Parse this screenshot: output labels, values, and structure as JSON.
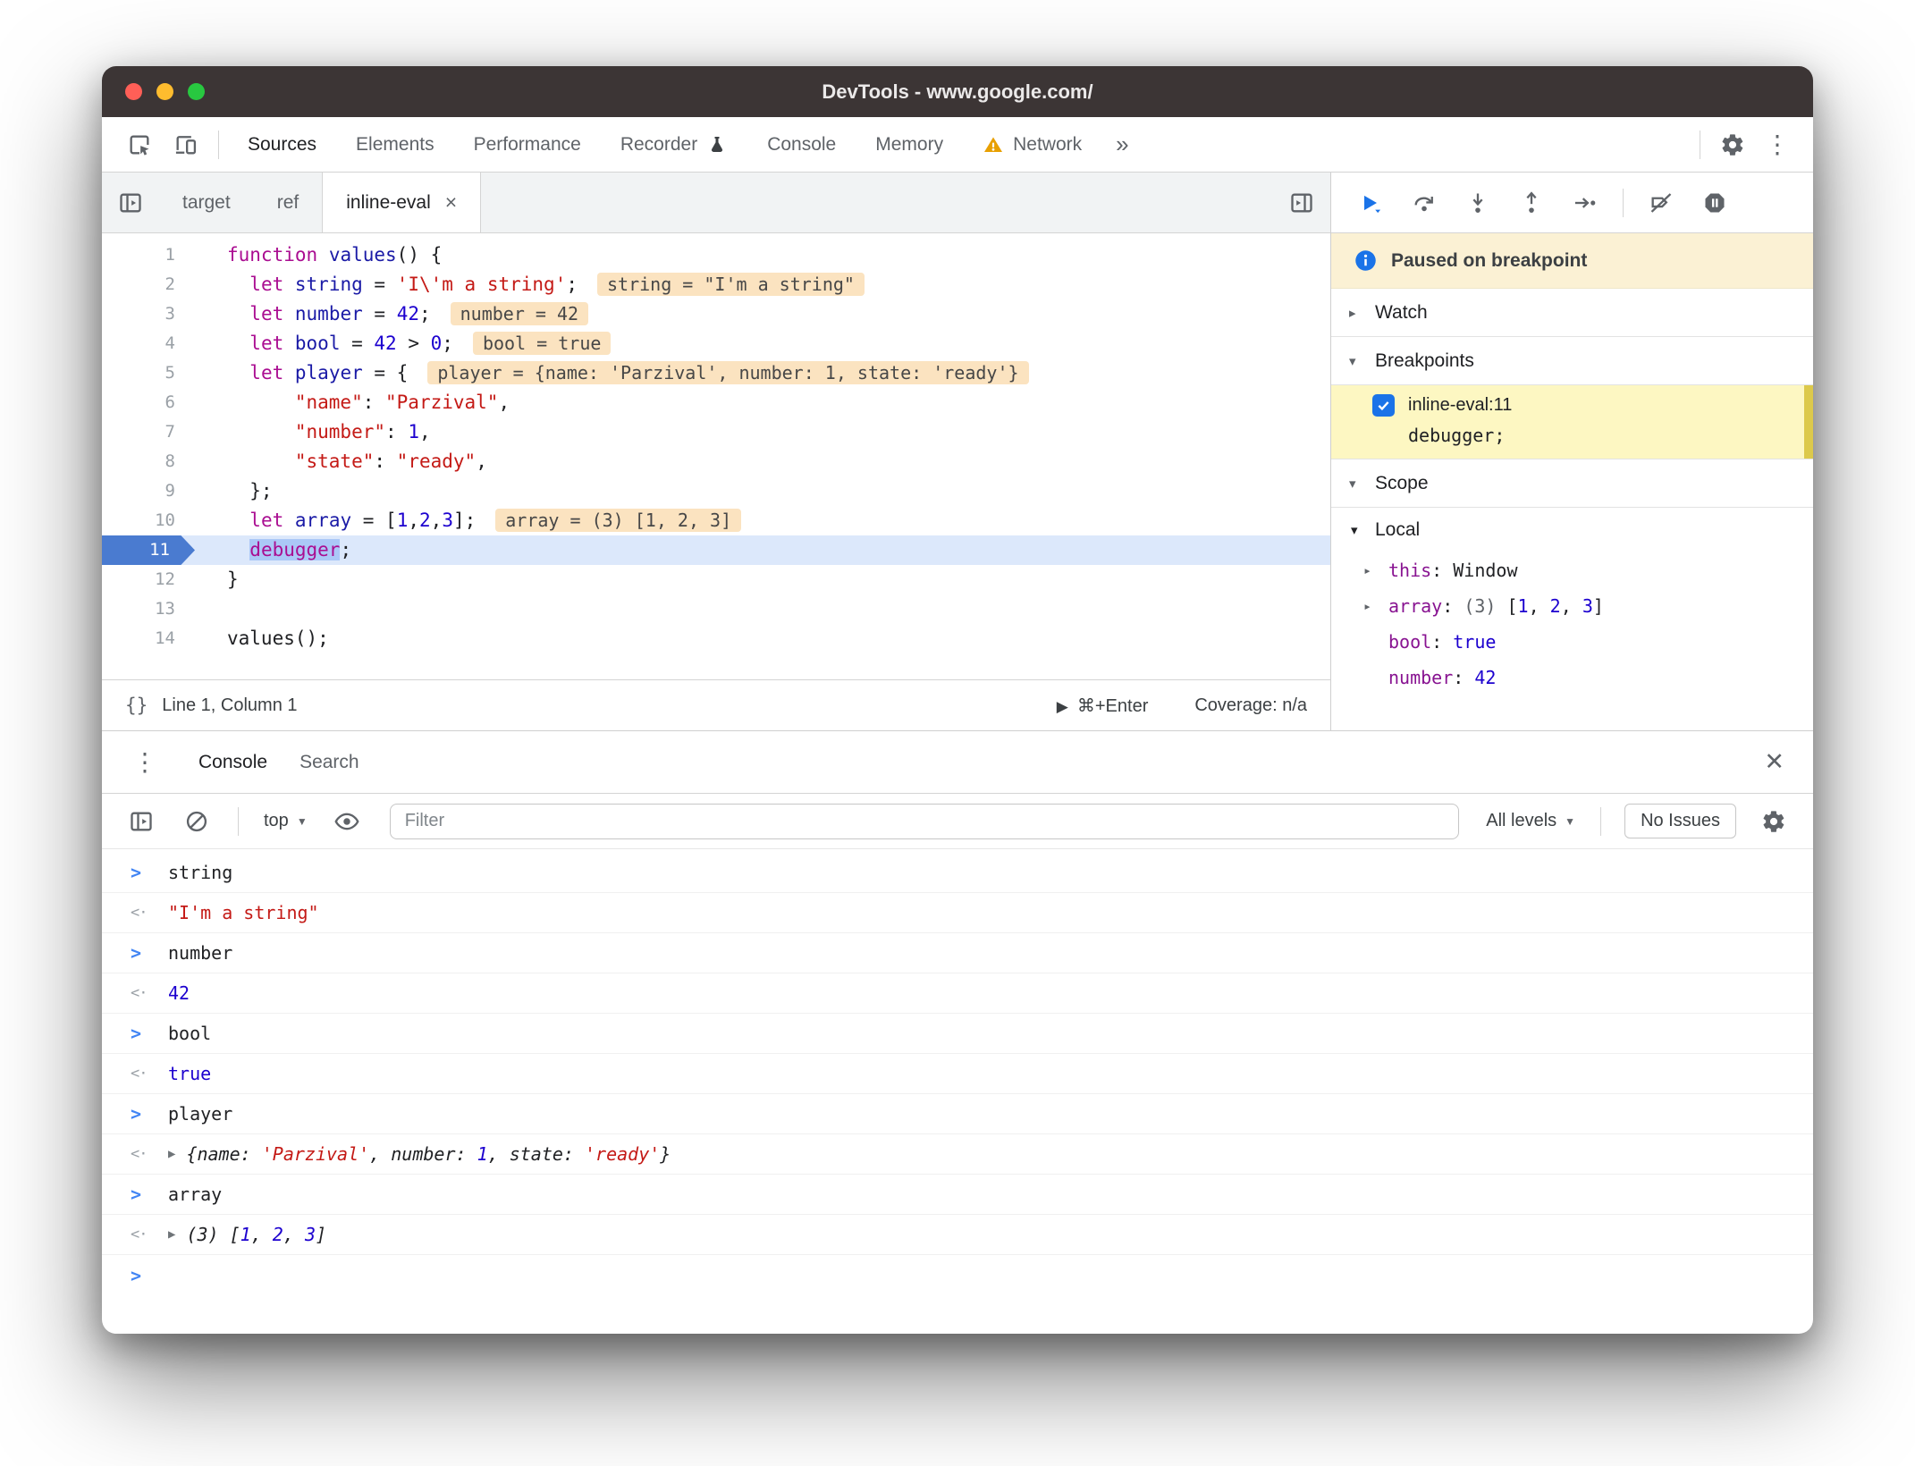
{
  "window": {
    "title": "DevTools - www.google.com/"
  },
  "toolbar": {
    "tabs": [
      "Sources",
      "Elements",
      "Performance",
      "Recorder",
      "Console",
      "Memory",
      "Network"
    ],
    "more": "»"
  },
  "filetabs": {
    "tabs": [
      "target",
      "ref",
      "inline-eval"
    ],
    "close": "×"
  },
  "editor": {
    "lines": [
      {
        "num": 1,
        "tokens": [
          [
            "kw",
            "function"
          ],
          [
            "pl",
            " "
          ],
          [
            "def",
            "values"
          ],
          [
            "pl",
            "() {"
          ]
        ]
      },
      {
        "num": 2,
        "tokens": [
          [
            "pl",
            "  "
          ],
          [
            "kw",
            "let"
          ],
          [
            "pl",
            " "
          ],
          [
            "def",
            "string"
          ],
          [
            "pl",
            " = "
          ],
          [
            "str",
            "'I\\'m a string'"
          ],
          [
            "pl",
            ";"
          ]
        ],
        "eval": "string = \"I'm a string\""
      },
      {
        "num": 3,
        "tokens": [
          [
            "pl",
            "  "
          ],
          [
            "kw",
            "let"
          ],
          [
            "pl",
            " "
          ],
          [
            "def",
            "number"
          ],
          [
            "pl",
            " = "
          ],
          [
            "num",
            "42"
          ],
          [
            "pl",
            ";"
          ]
        ],
        "eval": "number = 42"
      },
      {
        "num": 4,
        "tokens": [
          [
            "pl",
            "  "
          ],
          [
            "kw",
            "let"
          ],
          [
            "pl",
            " "
          ],
          [
            "def",
            "bool"
          ],
          [
            "pl",
            " = "
          ],
          [
            "num",
            "42"
          ],
          [
            "pl",
            " > "
          ],
          [
            "num",
            "0"
          ],
          [
            "pl",
            ";"
          ]
        ],
        "eval": "bool = true"
      },
      {
        "num": 5,
        "tokens": [
          [
            "pl",
            "  "
          ],
          [
            "kw",
            "let"
          ],
          [
            "pl",
            " "
          ],
          [
            "def",
            "player"
          ],
          [
            "pl",
            " = {"
          ]
        ],
        "eval": "player = {name: 'Parzival', number: 1, state: 'ready'}"
      },
      {
        "num": 6,
        "tokens": [
          [
            "pl",
            "      "
          ],
          [
            "str",
            "\"name\""
          ],
          [
            "pl",
            ": "
          ],
          [
            "str",
            "\"Parzival\""
          ],
          [
            "pl",
            ","
          ]
        ]
      },
      {
        "num": 7,
        "tokens": [
          [
            "pl",
            "      "
          ],
          [
            "str",
            "\"number\""
          ],
          [
            "pl",
            ": "
          ],
          [
            "num",
            "1"
          ],
          [
            "pl",
            ","
          ]
        ]
      },
      {
        "num": 8,
        "tokens": [
          [
            "pl",
            "      "
          ],
          [
            "str",
            "\"state\""
          ],
          [
            "pl",
            ": "
          ],
          [
            "str",
            "\"ready\""
          ],
          [
            "pl",
            ","
          ]
        ]
      },
      {
        "num": 9,
        "tokens": [
          [
            "pl",
            "  };"
          ]
        ]
      },
      {
        "num": 10,
        "tokens": [
          [
            "pl",
            "  "
          ],
          [
            "kw",
            "let"
          ],
          [
            "pl",
            " "
          ],
          [
            "def",
            "array"
          ],
          [
            "pl",
            " = ["
          ],
          [
            "num",
            "1"
          ],
          [
            "pl",
            ","
          ],
          [
            "num",
            "2"
          ],
          [
            "pl",
            ","
          ],
          [
            "num",
            "3"
          ],
          [
            "pl",
            "];"
          ]
        ],
        "eval": "array = (3) [1, 2, 3]"
      },
      {
        "num": 11,
        "current": true,
        "tokens": [
          [
            "pl",
            "  "
          ],
          [
            "kwsel",
            "debugger"
          ],
          [
            "pl",
            ";"
          ]
        ]
      },
      {
        "num": 12,
        "tokens": [
          [
            "pl",
            "}"
          ]
        ]
      },
      {
        "num": 13,
        "tokens": []
      },
      {
        "num": 14,
        "tokens": [
          [
            "pl",
            "values();"
          ]
        ]
      }
    ]
  },
  "statusbar": {
    "pretty_print": "{}",
    "position": "Line 1, Column 1",
    "run_hint": "⌘+Enter",
    "coverage": "Coverage: n/a"
  },
  "sidebar": {
    "paused": "Paused on breakpoint",
    "watch_label": "Watch",
    "breakpoints_label": "Breakpoints",
    "breakpoint": {
      "file": "inline-eval:11",
      "code": "debugger;"
    },
    "scope_label": "Scope",
    "local_label": "Local",
    "scope_entries": [
      {
        "expand": true,
        "name": "this",
        "value": [
          [
            "pl",
            "Window"
          ]
        ]
      },
      {
        "expand": true,
        "name": "array",
        "value": [
          [
            "gy",
            "(3) "
          ],
          [
            "pl",
            "["
          ],
          [
            "num",
            "1"
          ],
          [
            "pl",
            ", "
          ],
          [
            "num",
            "2"
          ],
          [
            "pl",
            ", "
          ],
          [
            "num",
            "3"
          ],
          [
            "pl",
            "]"
          ]
        ]
      },
      {
        "name": "bool",
        "value": [
          [
            "num",
            "true"
          ]
        ]
      },
      {
        "name": "number",
        "value": [
          [
            "num",
            "42"
          ]
        ]
      }
    ]
  },
  "console": {
    "tabs": [
      "Console",
      "Search"
    ],
    "context": "top",
    "filter_placeholder": "Filter",
    "levels": "All levels",
    "issues": "No Issues",
    "entries": [
      {
        "kind": "input",
        "tokens": [
          [
            "pl",
            "string"
          ]
        ]
      },
      {
        "kind": "result",
        "tokens": [
          [
            "str",
            "\"I'm a string\""
          ]
        ]
      },
      {
        "kind": "input",
        "tokens": [
          [
            "pl",
            "number"
          ]
        ]
      },
      {
        "kind": "result",
        "tokens": [
          [
            "num",
            "42"
          ]
        ]
      },
      {
        "kind": "input",
        "tokens": [
          [
            "pl",
            "bool"
          ]
        ]
      },
      {
        "kind": "result",
        "tokens": [
          [
            "num",
            "true"
          ]
        ]
      },
      {
        "kind": "input",
        "tokens": [
          [
            "pl",
            "player"
          ]
        ]
      },
      {
        "kind": "result",
        "expand": true,
        "italic": true,
        "tokens": [
          [
            "pl",
            "{name: "
          ],
          [
            "str",
            "'Parzival'"
          ],
          [
            "pl",
            ", number: "
          ],
          [
            "num",
            "1"
          ],
          [
            "pl",
            ", state: "
          ],
          [
            "str",
            "'ready'"
          ],
          [
            "pl",
            "}"
          ]
        ]
      },
      {
        "kind": "input",
        "tokens": [
          [
            "pl",
            "array"
          ]
        ]
      },
      {
        "kind": "result",
        "expand": true,
        "italic": true,
        "tokens": [
          [
            "pl",
            "(3) ["
          ],
          [
            "num",
            "1"
          ],
          [
            "pl",
            ", "
          ],
          [
            "num",
            "2"
          ],
          [
            "pl",
            ", "
          ],
          [
            "num",
            "3"
          ],
          [
            "pl",
            "]"
          ]
        ]
      },
      {
        "kind": "prompt"
      }
    ]
  },
  "colors": {
    "accent": "#1a73e8",
    "paused_banner": "#fbf1d4",
    "breakpoint_highlight": "#fdf7c2",
    "eval_hint": "#fbe3c0"
  }
}
